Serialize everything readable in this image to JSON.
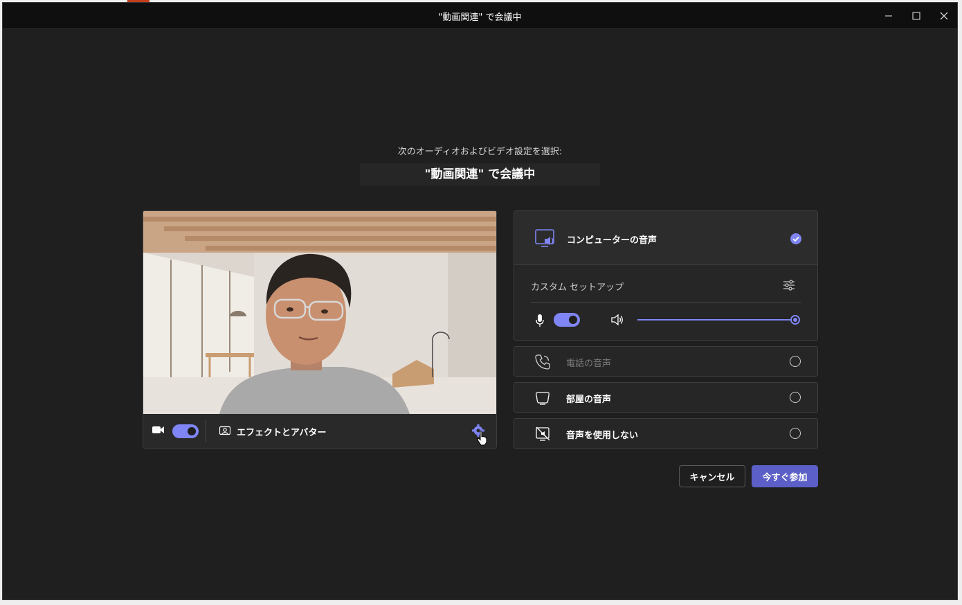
{
  "window": {
    "title": "\"動画関連\" で会議中"
  },
  "prejoin": {
    "subtitle": "次のオーディオおよびビデオ設定を選択:",
    "meeting_name": "\"動画関連\" で会議中"
  },
  "video": {
    "camera_on": true,
    "effects_label": "エフェクトとアバター"
  },
  "audio": {
    "computer_audio_label": "コンピューターの音声",
    "computer_audio_selected": true,
    "custom_setup_label": "カスタム セットアップ",
    "mic_on": true,
    "speaker_volume_fraction": 1.0,
    "options": [
      {
        "label": "電話の音声",
        "icon": "phone-icon",
        "disabled": true
      },
      {
        "label": "部屋の音声",
        "icon": "room-icon",
        "disabled": false
      },
      {
        "label": "音声を使用しない",
        "icon": "no-audio-icon",
        "disabled": false
      }
    ]
  },
  "buttons": {
    "cancel": "キャンセル",
    "join": "今すぐ参加"
  },
  "colors": {
    "accent": "#7f85f5",
    "join_button": "#5b5fc7",
    "background": "#1f1f1f"
  }
}
